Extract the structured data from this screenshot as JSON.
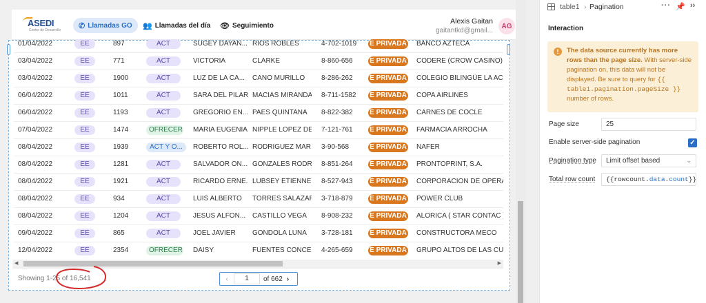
{
  "app": {
    "logo_text": "ASEDI",
    "logo_sub": "Centro de Desarrollo",
    "nav": [
      {
        "label": "Llamadas GO",
        "icon": "phone-icon",
        "active": true
      },
      {
        "label": "Llamadas del día",
        "icon": "users-icon",
        "active": false
      },
      {
        "label": "Seguimiento",
        "icon": "eye-icon",
        "active": false
      }
    ],
    "user": {
      "name": "Alexis Gaitan",
      "email": "gaitantkd@gmail...",
      "initials": "AG"
    }
  },
  "table": {
    "rows": [
      {
        "date": "01/04/2022",
        "ee": "EE",
        "num": "897",
        "tag": "ACT",
        "tag_type": "act",
        "name": "SUGEY DAYAN...",
        "last": "RIOS ROBLES",
        "phone": "4-702-1019",
        "type": "E PRIVADA",
        "company": "BANCO AZTECA"
      },
      {
        "date": "03/04/2022",
        "ee": "EE",
        "num": "771",
        "tag": "ACT",
        "tag_type": "act",
        "name": "VICTORIA",
        "last": "CLARKE",
        "phone": "8-860-656",
        "type": "E PRIVADA",
        "company": "CODERE (CROW CASINO)"
      },
      {
        "date": "03/04/2022",
        "ee": "EE",
        "num": "1900",
        "tag": "ACT",
        "tag_type": "act",
        "name": "LUZ DE LA CA...",
        "last": "CANO MURILLO",
        "phone": "8-286-262",
        "type": "E PRIVADA",
        "company": "COLEGIO BILINGÜE LA ACADE"
      },
      {
        "date": "06/04/2022",
        "ee": "EE",
        "num": "1011",
        "tag": "ACT",
        "tag_type": "act",
        "name": "SARA DEL PILAR",
        "last": "MACIAS MIRANDA",
        "phone": "8-711-1582",
        "type": "E PRIVADA",
        "company": "COPA AIRLINES"
      },
      {
        "date": "06/04/2022",
        "ee": "EE",
        "num": "1193",
        "tag": "ACT",
        "tag_type": "act",
        "name": "GREGORIO EN...",
        "last": "PAES QUINTANA",
        "phone": "8-822-382",
        "type": "E PRIVADA",
        "company": "CARNES DE COCLE"
      },
      {
        "date": "07/04/2022",
        "ee": "EE",
        "num": "1474",
        "tag": "OFRECER",
        "tag_type": "of",
        "name": "MARIA EUGENIA",
        "last": "NIPPLE LOPEZ DE ...",
        "phone": "7-121-761",
        "type": "E PRIVADA",
        "company": "FARMACIA ARROCHA"
      },
      {
        "date": "08/04/2022",
        "ee": "EE",
        "num": "1939",
        "tag": "ACT Y O...",
        "tag_type": "acty",
        "name": "ROBERTO ROL...",
        "last": "RODRIGUEZ MAR...",
        "phone": "3-90-568",
        "type": "E PRIVADA",
        "company": "NAFER"
      },
      {
        "date": "08/04/2022",
        "ee": "EE",
        "num": "1281",
        "tag": "ACT",
        "tag_type": "act",
        "name": "SALVADOR ON...",
        "last": "GONZALES RODRI...",
        "phone": "8-851-264",
        "type": "E PRIVADA",
        "company": "PRONTOPRINT, S.A."
      },
      {
        "date": "08/04/2022",
        "ee": "EE",
        "num": "1921",
        "tag": "ACT",
        "tag_type": "act",
        "name": "RICARDO ERNE...",
        "last": "LUBSEY ETIENNE",
        "phone": "8-527-943",
        "type": "E PRIVADA",
        "company": "CORPORACION DE OPERACIO"
      },
      {
        "date": "08/04/2022",
        "ee": "EE",
        "num": "934",
        "tag": "ACT",
        "tag_type": "act",
        "name": "LUIS ALBERTO",
        "last": "TORRES SALAZAR",
        "phone": "3-718-879",
        "type": "E PRIVADA",
        "company": "POWER CLUB"
      },
      {
        "date": "08/04/2022",
        "ee": "EE",
        "num": "1204",
        "tag": "ACT",
        "tag_type": "act",
        "name": "JESUS ALFON...",
        "last": "CASTILLO VEGA",
        "phone": "8-908-232",
        "type": "E PRIVADA",
        "company": "ALORICA ( STAR CONTAC )"
      },
      {
        "date": "09/04/2022",
        "ee": "EE",
        "num": "865",
        "tag": "ACT",
        "tag_type": "act",
        "name": "JOEL JAVIER",
        "last": "GONDOLA LUNA",
        "phone": "3-728-181",
        "type": "E PRIVADA",
        "company": "CONSTRUCTORA MECO"
      },
      {
        "date": "12/04/2022",
        "ee": "EE",
        "num": "2354",
        "tag": "OFRECER",
        "tag_type": "of",
        "name": "DAISY",
        "last": "FUENTES CONCE...",
        "phone": "4-265-659",
        "type": "E PRIVADA",
        "company": "GRUPO ALTOS DE LAS CUMB"
      }
    ],
    "showing": "Showing 1-25 of 16,541",
    "page_current": "1",
    "page_of": "of 662"
  },
  "panel": {
    "breadcrumb_table": "table1",
    "breadcrumb_sep": "›",
    "breadcrumb_section": "Pagination",
    "section_title": "Interaction",
    "warning_bold": "The data source currently has more rows than the page size.",
    "warning_text": " With server-side pagination on, this data will not be displayed. Be sure to query for ",
    "warning_code": "{{ table1.pagination.pageSize }}",
    "warning_tail": " number of rows.",
    "props": {
      "page_size_label": "Page size",
      "page_size_value": "25",
      "server_side_label": "Enable server-side pagination",
      "server_side_checked": true,
      "pagination_type_label": "Pagination type",
      "pagination_type_value": "Limit offset based",
      "total_row_label": "Total row count",
      "total_row_prefix": "{{rowcount.",
      "total_row_kw1": "data",
      "total_row_dot": ".",
      "total_row_kw2": "count",
      "total_row_suffix": "}}"
    }
  }
}
